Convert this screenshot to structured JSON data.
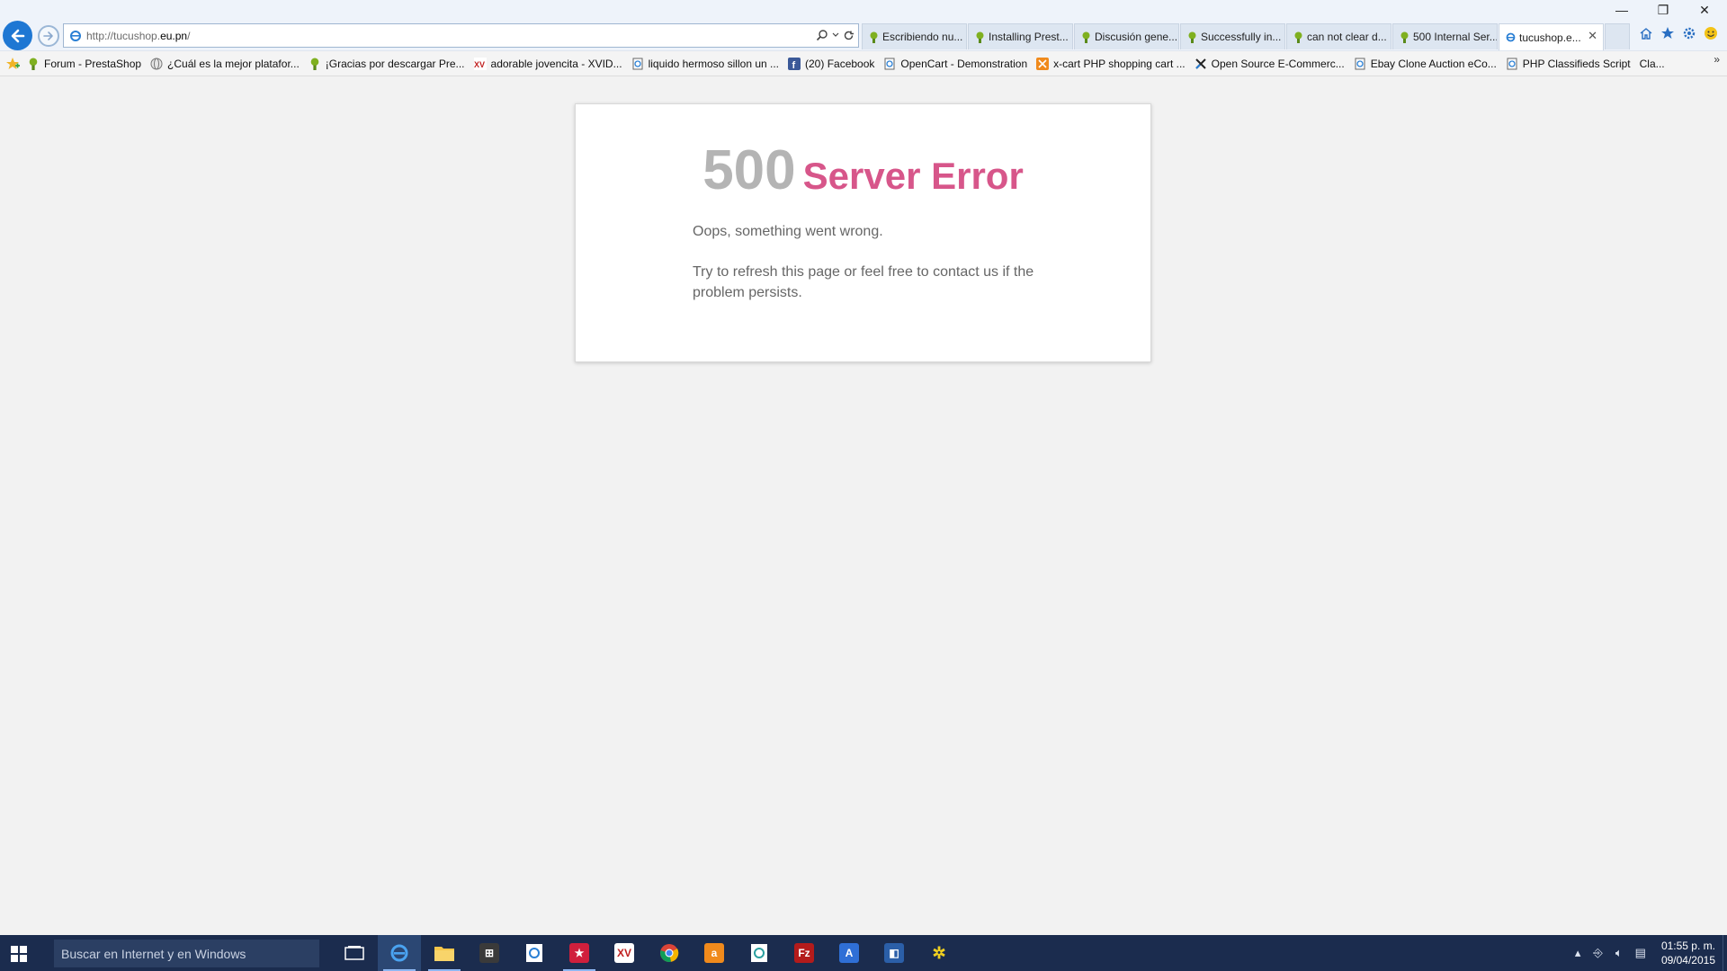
{
  "browser": {
    "url_prefix": "http://tucushop.",
    "url_domain": "eu.pn",
    "url_suffix": "/",
    "tabs": [
      {
        "title": "Escribiendo nu...",
        "active": false
      },
      {
        "title": "Installing Prest...",
        "active": false
      },
      {
        "title": "Discusión gene...",
        "active": false
      },
      {
        "title": "Successfully in...",
        "active": false
      },
      {
        "title": "can not clear d...",
        "active": false
      },
      {
        "title": "500 Internal Ser...",
        "active": false
      },
      {
        "title": "tucushop.e...",
        "active": true
      }
    ],
    "tab_close": "✕",
    "window_controls": {
      "minimize": "—",
      "restore": "❐",
      "close": "✕"
    }
  },
  "favorites": {
    "items": [
      {
        "label": "Forum - PrestaShop",
        "icon": "prestashop-icon"
      },
      {
        "label": "¿Cuál es la mejor platafor...",
        "icon": "globe-icon"
      },
      {
        "label": "¡Gracias por descargar Pre...",
        "icon": "prestashop-icon"
      },
      {
        "label": "adorable jovencita - XVID...",
        "icon": "xv-icon"
      },
      {
        "label": "liquido hermoso sillon un ...",
        "icon": "page-icon"
      },
      {
        "label": "(20) Facebook",
        "icon": "facebook-icon"
      },
      {
        "label": "OpenCart - Demonstration",
        "icon": "page-icon"
      },
      {
        "label": "x-cart PHP shopping cart ...",
        "icon": "xcart-icon"
      },
      {
        "label": "Open Source E-Commerc...",
        "icon": "xcart-x-icon"
      },
      {
        "label": "Ebay Clone Auction eCo...",
        "icon": "page-icon"
      },
      {
        "label": "PHP Classifieds Script",
        "icon": "page-icon"
      },
      {
        "label": "Cla...",
        "icon": "none"
      }
    ],
    "more": "»"
  },
  "page": {
    "error_code": "500",
    "error_title": "Server Error",
    "message1": "Oops, something went wrong.",
    "message2": "Try to refresh this page or feel free to contact us if the problem persists."
  },
  "taskbar": {
    "search_placeholder": "Buscar en Internet y en Windows",
    "time": "01:55 p. m.",
    "date": "09/04/2015"
  },
  "colors": {
    "error_code": "#b4b4b4",
    "error_title": "#d7568a",
    "taskbar": "#1b2c4e",
    "accent_blue": "#1e77d3"
  }
}
